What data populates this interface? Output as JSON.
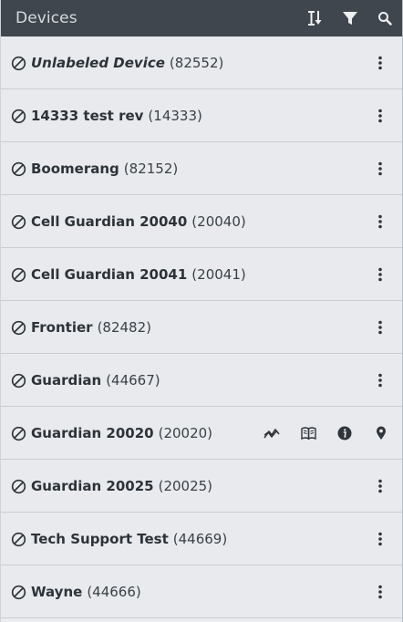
{
  "header": {
    "title": "Devices",
    "icons": [
      "sort-icon",
      "filter-icon",
      "search-icon"
    ]
  },
  "devices": [
    {
      "name": "Unlabeled Device",
      "id": "(82552)",
      "italic": true
    },
    {
      "name": "14333 test rev",
      "id": "(14333)"
    },
    {
      "name": "Boomerang",
      "id": "(82152)"
    },
    {
      "name": "Cell Guardian 20040",
      "id": "(20040)"
    },
    {
      "name": "Cell Guardian 20041",
      "id": "(20041)"
    },
    {
      "name": "Frontier",
      "id": "(82482)"
    },
    {
      "name": "Guardian",
      "id": "(44667)"
    },
    {
      "name": "Guardian 20020",
      "id": "(20020)",
      "expanded_actions": [
        "chart-icon",
        "book-icon",
        "info-icon",
        "location-pin-icon"
      ]
    },
    {
      "name": "Guardian 20025",
      "id": "(20025)"
    },
    {
      "name": "Tech Support Test",
      "id": "(44669)"
    },
    {
      "name": "Wayne",
      "id": "(44666)"
    }
  ],
  "colors": {
    "header_bg": "#3f464d",
    "row_bg": "#e8eaed",
    "text": "#2d3339"
  }
}
